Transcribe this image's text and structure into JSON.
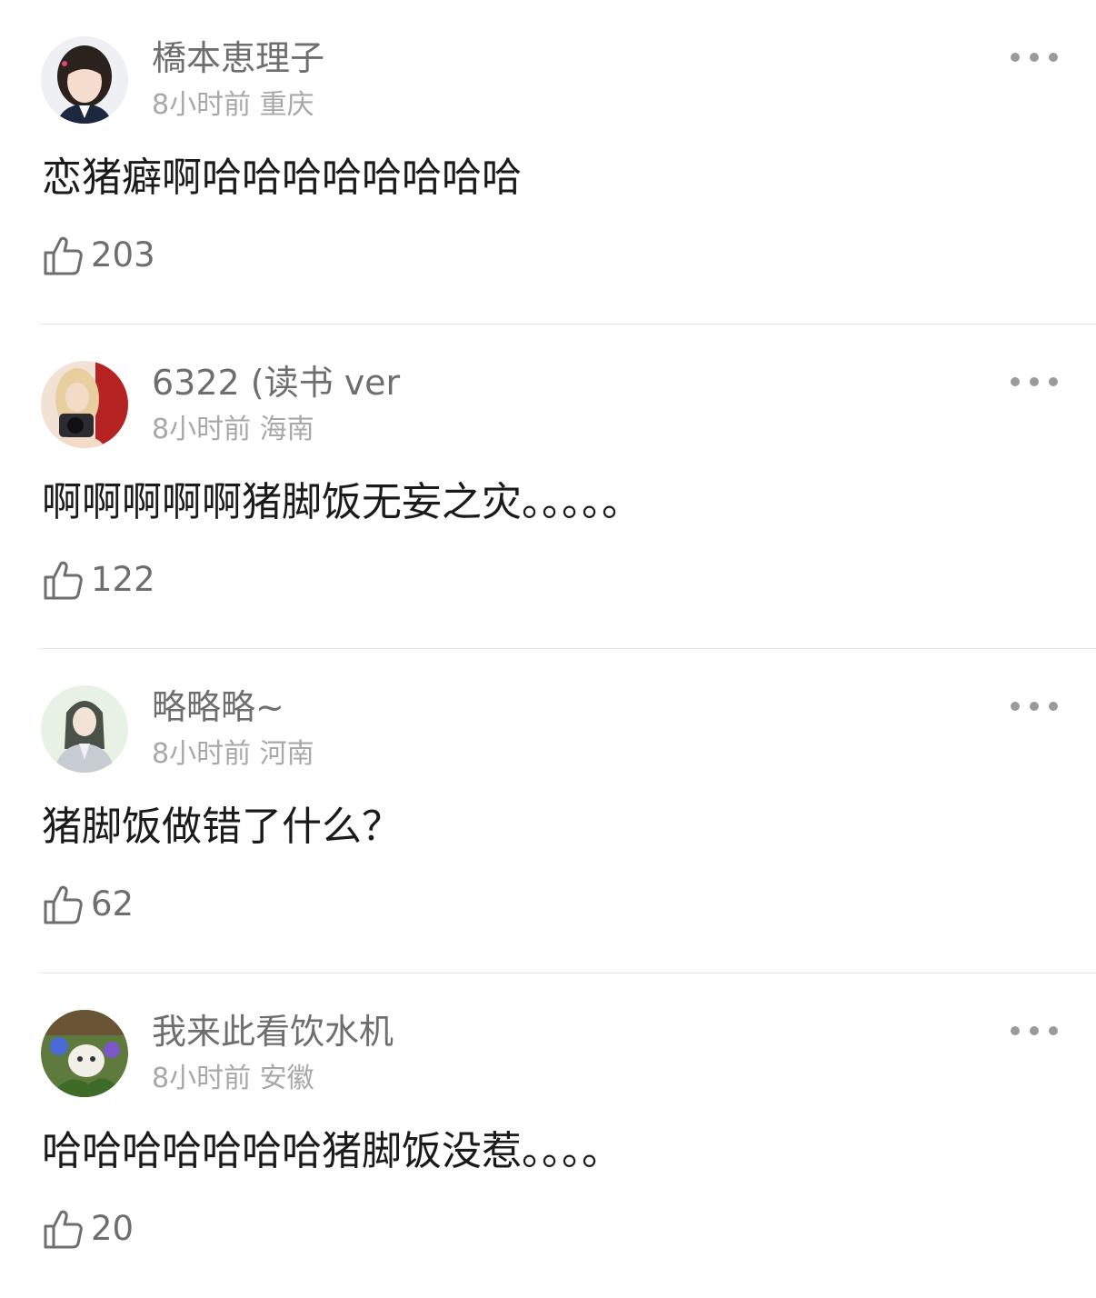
{
  "comments": [
    {
      "username": "橋本恵理子",
      "time": "8小时前",
      "location": "重庆",
      "text": "恋猪癖啊哈哈哈哈哈哈哈哈",
      "likes": "203",
      "avatar": "avatar-girl-portrait"
    },
    {
      "username": "6322 (读书 ver",
      "time": "8小时前",
      "location": "海南",
      "text": "啊啊啊啊啊猪脚饭无妄之灾。。。。。",
      "likes": "122",
      "avatar": "avatar-girl-with-camera"
    },
    {
      "username": "略略略~",
      "time": "8小时前",
      "location": "河南",
      "text": "猪脚饭做错了什么？",
      "likes": "62",
      "avatar": "avatar-anime-character"
    },
    {
      "username": "我来此看饮水机",
      "time": "8小时前",
      "location": "安徽",
      "text": "哈哈哈哈哈哈哈猪脚饭没惹。。。。",
      "likes": "20",
      "avatar": "avatar-cat-in-flowers"
    }
  ],
  "icons": {
    "like": "thumbs-up-icon",
    "more": "more-options-icon"
  },
  "colors": {
    "username": "#6e6e6e",
    "meta": "#a8a8a8",
    "text": "#1a1a1a",
    "divider": "#e5e5e5"
  }
}
